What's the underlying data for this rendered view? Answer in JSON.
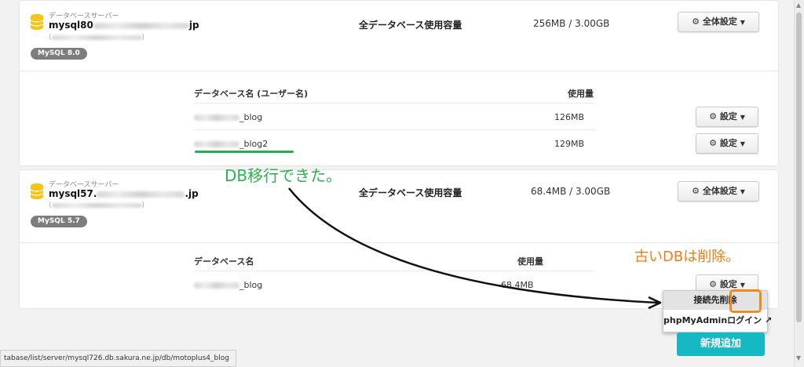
{
  "servers": [
    {
      "caption": "データベースサーバー",
      "host_prefix": "mysql80",
      "host_suffix": "jp",
      "sub_open": "(",
      "sub_close": ")",
      "version": "MySQL 8.0",
      "usage_label": "全データベース使用容量",
      "usage_value": "256MB / 3.00GB",
      "settings_label": "全体設定",
      "table": {
        "col_name": "データベース名 (ユーザー名)",
        "col_size": "使用量",
        "rows": [
          {
            "name_suffix": "_blog",
            "size": "126MB",
            "settings_label": "設定"
          },
          {
            "name_suffix": "_blog2",
            "size": "129MB",
            "settings_label": "設定"
          }
        ]
      }
    },
    {
      "caption": "データベースサーバー",
      "host_prefix": "mysql57.",
      "host_suffix": ".jp",
      "sub_open": "(",
      "sub_close": ")",
      "version": "MySQL 5.7",
      "usage_label": "全データベース使用容量",
      "usage_value": "68.4MB / 3.00GB",
      "settings_label": "全体設定",
      "table": {
        "col_name": "データベース名",
        "col_size": "使用量",
        "rows": [
          {
            "name_suffix": "_blog",
            "size": "68.4MB",
            "settings_label": "設定"
          }
        ]
      }
    }
  ],
  "dropdown": {
    "item1_prefix": "接続先",
    "item1_highlight": "削除",
    "item2": "phpMyAdminログイン"
  },
  "add_button": "新規追加",
  "annotations": {
    "migrated": "DB移行できた。",
    "delete_old": "古いDBは削除。"
  },
  "status_url": "tabase/list/server/mysql726.db.sakura.ne.jp/db/motoplus4_blog",
  "colors": {
    "accent": "#14b9c4",
    "annotation_green": "#2bb24c",
    "annotation_orange": "#f07d14",
    "db_icon": "#f5c518"
  },
  "icons": [
    "database-icon",
    "gear-icon",
    "chevron-down-icon",
    "external-link-icon"
  ]
}
